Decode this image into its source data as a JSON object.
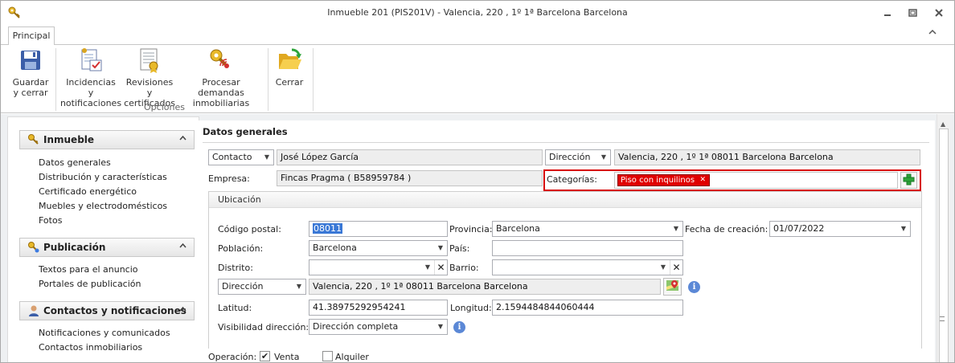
{
  "window": {
    "title": "Inmueble 201 (PIS201V) - Valencia, 220 , 1º 1ª Barcelona Barcelona"
  },
  "ribbon": {
    "tab_label": "Principal",
    "group_label": "Opciones",
    "buttons": [
      {
        "line1": "Guardar",
        "line2": "y cerrar",
        "icon": "floppy-disk-icon"
      },
      {
        "line1": "Incidencias y",
        "line2": "notificaciones",
        "icon": "checklist-icon"
      },
      {
        "line1": "Revisiones y",
        "line2": "certificados",
        "icon": "certificate-icon"
      },
      {
        "line1": "Procesar demandas",
        "line2": "inmobiliarias",
        "icon": "key-signal-icon"
      },
      {
        "line1": "Cerrar",
        "line2": "",
        "icon": "folder-open-icon"
      }
    ]
  },
  "nav": {
    "sections": [
      {
        "title": "Inmueble",
        "items": [
          "Datos generales",
          "Distribución y características",
          "Certificado energético",
          "Muebles y electrodomésticos",
          "Fotos"
        ]
      },
      {
        "title": "Publicación",
        "items": [
          "Textos para el anuncio",
          "Portales de publicación"
        ]
      },
      {
        "title": "Contactos y notificaciones",
        "items": [
          "Notificaciones y comunicados",
          "Contactos inmobiliarios"
        ]
      }
    ]
  },
  "form": {
    "section_title": "Datos generales",
    "contacto_type": "Contacto",
    "contacto_name": "José López García",
    "direccion_type": "Dirección",
    "direccion_value": "Valencia, 220 , 1º 1ª 08011 Barcelona Barcelona",
    "empresa_label": "Empresa:",
    "empresa_value": "Fincas Pragma ( B58959784 )",
    "categorias_label": "Categorías:",
    "categoria_tag": "Piso con inquilinos",
    "ubicacion": {
      "title": "Ubicación",
      "codigo_postal_label": "Código postal:",
      "codigo_postal": "08011",
      "provincia_label": "Provincia:",
      "provincia": "Barcelona",
      "fecha_label": "Fecha de creación:",
      "fecha": "01/07/2022",
      "poblacion_label": "Población:",
      "poblacion": "Barcelona",
      "pais_label": "País:",
      "pais": "",
      "distrito_label": "Distrito:",
      "distrito": "",
      "barrio_label": "Barrio:",
      "barrio": "",
      "direccion_type": "Dirección",
      "direccion_value": "Valencia, 220 , 1º 1ª 08011 Barcelona Barcelona",
      "latitud_label": "Latitud:",
      "latitud": "41.38975292954241",
      "longitud_label": "Longitud:",
      "longitud": "2.1594484844060444",
      "visibilidad_label": "Visibilidad dirección:",
      "visibilidad": "Dirección completa"
    },
    "operacion_label": "Operación:",
    "venta_label": "Venta",
    "venta_checked": true,
    "alquiler_label": "Alquiler",
    "alquiler_checked": false
  },
  "colors": {
    "accent": "#3a78d6",
    "tag_red": "#e00000",
    "highlight_border": "#d70000"
  }
}
